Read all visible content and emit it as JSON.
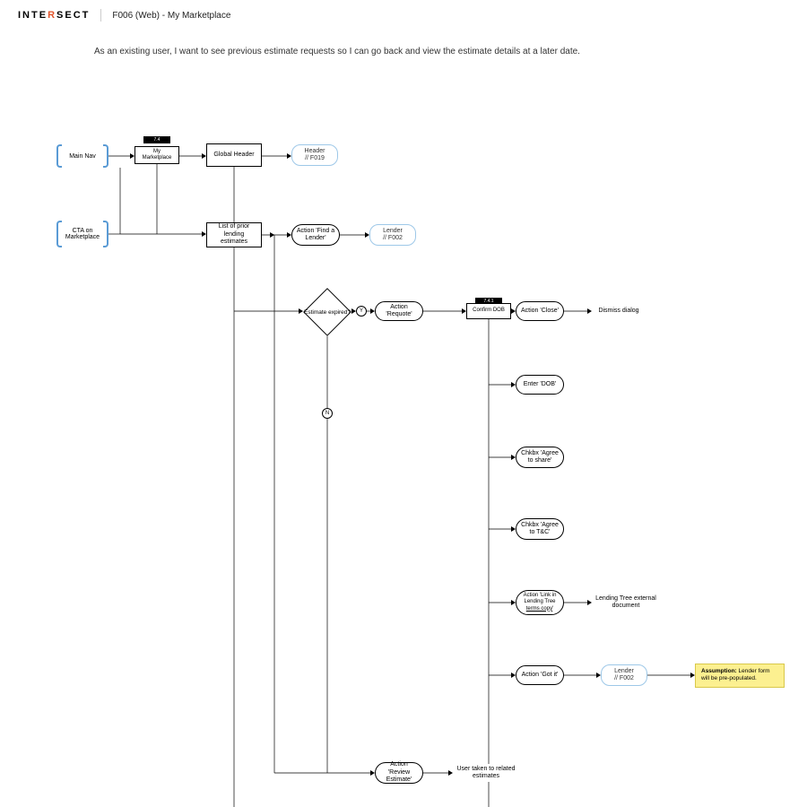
{
  "header": {
    "logo_a": "INTE",
    "logo_b": "R",
    "logo_c": "SECT",
    "title": "F006 (Web) - My Marketplace"
  },
  "description": "As an existing user, I want to see previous estimate requests so I can go back and view the estimate details at a later date.",
  "nodes": {
    "main_nav": "Main Nav",
    "cta": "CTA on Marketplace",
    "my_mkt": "My Marketplace",
    "global_header": "Global Header",
    "header_ref": "Header\n// F019",
    "list_prior": "List of prior lending estimates",
    "find_lender": "Action 'Find a Lender'",
    "lender_ref": "Lender\n// F002",
    "expired": "Estimate expired?",
    "requote": "Action 'Requote'",
    "confirm_dob": "Confirm DOB",
    "close": "Action 'Close'",
    "dismiss": "Dismiss dialog",
    "enter_dob": "Enter 'DOB'",
    "agree_share": "Chkbx 'Agree to share'",
    "agree_tc": "Chkbx 'Agree to T&C'",
    "link_terms": "Action 'Link in Lending Tree terms copy'",
    "lt_ext": "Lending Tree external document",
    "got_it": "Action 'Got it'",
    "lender_ref2": "Lender\n// F002",
    "review": "Action 'Review Estimate'",
    "related": "User taken to related estimates",
    "y": "Y",
    "n": "N"
  },
  "tags": {
    "t1": "7.4",
    "t2": "7.4.1"
  },
  "note": {
    "bold": "Assumption:",
    "rest": " Lender form will be pre-populated."
  }
}
